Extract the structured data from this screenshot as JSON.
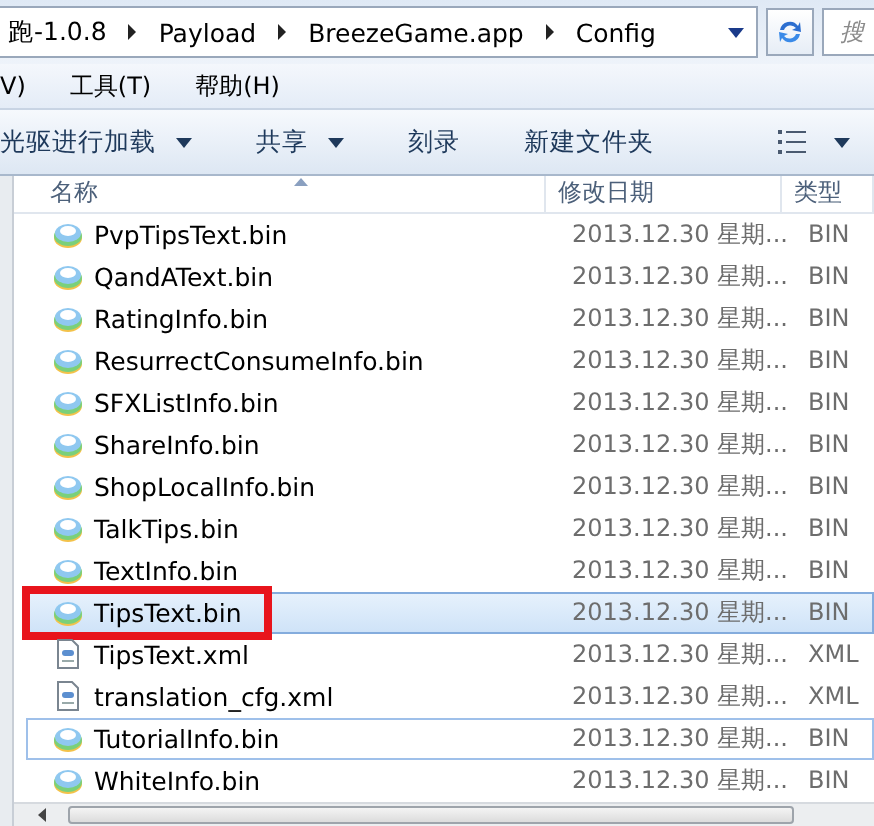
{
  "address_bar": {
    "crumbs": [
      "跑-1.0.8",
      "Payload",
      "BreezeGame.app",
      "Config"
    ],
    "search": {
      "placeholder": "搜"
    }
  },
  "menu_bar": [
    "V)",
    "工具(T)",
    "帮助(H)"
  ],
  "toolbar": [
    {
      "label": "光驱进行加载",
      "dropdown": true
    },
    {
      "label": "共享",
      "dropdown": true
    },
    {
      "label": "刻录",
      "dropdown": false
    },
    {
      "label": "新建文件夹",
      "dropdown": false
    }
  ],
  "columns": [
    "名称",
    "修改日期",
    "类型"
  ],
  "rows": [
    {
      "name": "PvpTipsText.bin",
      "date": "2013.12.30 星期...",
      "type": "BIN",
      "kind": "bin",
      "selected": false,
      "focused": false,
      "highlighted": false
    },
    {
      "name": "QandAText.bin",
      "date": "2013.12.30 星期...",
      "type": "BIN",
      "kind": "bin",
      "selected": false,
      "focused": false,
      "highlighted": false
    },
    {
      "name": "RatingInfo.bin",
      "date": "2013.12.30 星期...",
      "type": "BIN",
      "kind": "bin",
      "selected": false,
      "focused": false,
      "highlighted": false
    },
    {
      "name": "ResurrectConsumeInfo.bin",
      "date": "2013.12.30 星期...",
      "type": "BIN",
      "kind": "bin",
      "selected": false,
      "focused": false,
      "highlighted": false
    },
    {
      "name": "SFXListInfo.bin",
      "date": "2013.12.30 星期...",
      "type": "BIN",
      "kind": "bin",
      "selected": false,
      "focused": false,
      "highlighted": false
    },
    {
      "name": "ShareInfo.bin",
      "date": "2013.12.30 星期...",
      "type": "BIN",
      "kind": "bin",
      "selected": false,
      "focused": false,
      "highlighted": false
    },
    {
      "name": "ShopLocalInfo.bin",
      "date": "2013.12.30 星期...",
      "type": "BIN",
      "kind": "bin",
      "selected": false,
      "focused": false,
      "highlighted": false
    },
    {
      "name": "TalkTips.bin",
      "date": "2013.12.30 星期...",
      "type": "BIN",
      "kind": "bin",
      "selected": false,
      "focused": false,
      "highlighted": false
    },
    {
      "name": "TextInfo.bin",
      "date": "2013.12.30 星期...",
      "type": "BIN",
      "kind": "bin",
      "selected": false,
      "focused": false,
      "highlighted": false
    },
    {
      "name": "TipsText.bin",
      "date": "2013.12.30 星期...",
      "type": "BIN",
      "kind": "bin",
      "selected": true,
      "focused": false,
      "highlighted": true
    },
    {
      "name": "TipsText.xml",
      "date": "2013.12.30 星期...",
      "type": "XML",
      "kind": "xml",
      "selected": false,
      "focused": false,
      "highlighted": false
    },
    {
      "name": "translation_cfg.xml",
      "date": "2013.12.30 星期...",
      "type": "XML",
      "kind": "xml",
      "selected": false,
      "focused": false,
      "highlighted": false
    },
    {
      "name": "TutorialInfo.bin",
      "date": "2013.12.30 星期...",
      "type": "BIN",
      "kind": "bin",
      "selected": false,
      "focused": true,
      "highlighted": false
    },
    {
      "name": "WhiteInfo.bin",
      "date": "2013.12.30 星期...",
      "type": "BIN",
      "kind": "bin",
      "selected": false,
      "focused": false,
      "highlighted": false
    }
  ]
}
